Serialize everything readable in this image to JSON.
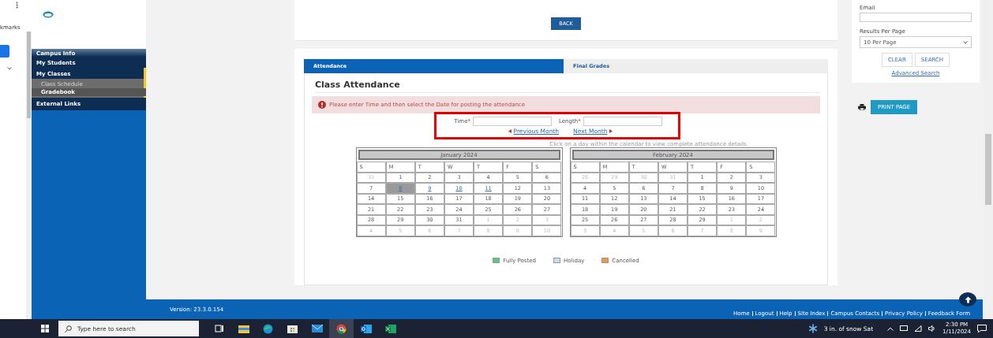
{
  "browser": {
    "bookmarks_label": "kmarks"
  },
  "sidebar": {
    "items": [
      {
        "label": "Campus Info",
        "selected": false
      },
      {
        "label": "My Students",
        "selected": false
      },
      {
        "label": "My Classes",
        "selected": true,
        "expanded": true,
        "children": [
          {
            "label": "Class Schedule",
            "selected": false
          },
          {
            "label": "Gradebook",
            "selected": true
          }
        ]
      },
      {
        "label": "External Links",
        "selected": false
      }
    ]
  },
  "back_button": "BACK",
  "tabs": [
    {
      "label": "Attendance",
      "selected": true
    },
    {
      "label": "Final Grades",
      "selected": false
    }
  ],
  "heading": "Class Attendance",
  "alert": "Please enter Time and then select the Date for posting the attendance",
  "form": {
    "fields": [
      {
        "label": "Time",
        "required_mark": "*"
      },
      {
        "label": "Length",
        "required_mark": "*"
      }
    ],
    "prev_link": "Previous Month",
    "next_link": "Next Month",
    "hint": "Click on a day within the calendar to view complete attendance details."
  },
  "calendars": [
    {
      "title": "January 2024",
      "weekdays": [
        "S",
        "M",
        "T",
        "W",
        "T",
        "F",
        "S"
      ],
      "weeks": [
        [
          {
            "day": "31",
            "muted": true,
            "linked": false,
            "selected": false
          },
          {
            "day": "1",
            "muted": false,
            "linked": false,
            "selected": false
          },
          {
            "day": "2",
            "muted": false,
            "linked": false,
            "selected": false
          },
          {
            "day": "3",
            "muted": false,
            "linked": false,
            "selected": false
          },
          {
            "day": "4",
            "muted": false,
            "linked": false,
            "selected": false
          },
          {
            "day": "5",
            "muted": false,
            "linked": false,
            "selected": false
          },
          {
            "day": "6",
            "muted": false,
            "linked": false,
            "selected": false
          }
        ],
        [
          {
            "day": "7",
            "muted": false,
            "linked": false,
            "selected": false
          },
          {
            "day": "8",
            "muted": false,
            "linked": true,
            "selected": true
          },
          {
            "day": "9",
            "muted": false,
            "linked": true,
            "selected": false
          },
          {
            "day": "10",
            "muted": false,
            "linked": true,
            "selected": false
          },
          {
            "day": "11",
            "muted": false,
            "linked": true,
            "selected": false
          },
          {
            "day": "12",
            "muted": false,
            "linked": false,
            "selected": false
          },
          {
            "day": "13",
            "muted": false,
            "linked": false,
            "selected": false
          }
        ],
        [
          {
            "day": "14",
            "muted": false,
            "linked": false,
            "selected": false
          },
          {
            "day": "15",
            "muted": false,
            "linked": false,
            "selected": false
          },
          {
            "day": "16",
            "muted": false,
            "linked": false,
            "selected": false
          },
          {
            "day": "17",
            "muted": false,
            "linked": false,
            "selected": false
          },
          {
            "day": "18",
            "muted": false,
            "linked": false,
            "selected": false
          },
          {
            "day": "19",
            "muted": false,
            "linked": false,
            "selected": false
          },
          {
            "day": "20",
            "muted": false,
            "linked": false,
            "selected": false
          }
        ],
        [
          {
            "day": "21",
            "muted": false,
            "linked": false,
            "selected": false
          },
          {
            "day": "22",
            "muted": false,
            "linked": false,
            "selected": false
          },
          {
            "day": "23",
            "muted": false,
            "linked": false,
            "selected": false
          },
          {
            "day": "24",
            "muted": false,
            "linked": false,
            "selected": false
          },
          {
            "day": "25",
            "muted": false,
            "linked": false,
            "selected": false
          },
          {
            "day": "26",
            "muted": false,
            "linked": false,
            "selected": false
          },
          {
            "day": "27",
            "muted": false,
            "linked": false,
            "selected": false
          }
        ],
        [
          {
            "day": "28",
            "muted": false,
            "linked": false,
            "selected": false
          },
          {
            "day": "29",
            "muted": false,
            "linked": false,
            "selected": false
          },
          {
            "day": "30",
            "muted": false,
            "linked": false,
            "selected": false
          },
          {
            "day": "31",
            "muted": false,
            "linked": false,
            "selected": false
          },
          {
            "day": "1",
            "muted": true,
            "linked": false,
            "selected": false
          },
          {
            "day": "2",
            "muted": true,
            "linked": false,
            "selected": false
          },
          {
            "day": "3",
            "muted": true,
            "linked": false,
            "selected": false
          }
        ],
        [
          {
            "day": "4",
            "muted": true,
            "linked": false,
            "selected": false
          },
          {
            "day": "5",
            "muted": true,
            "linked": false,
            "selected": false
          },
          {
            "day": "6",
            "muted": true,
            "linked": false,
            "selected": false
          },
          {
            "day": "7",
            "muted": true,
            "linked": false,
            "selected": false
          },
          {
            "day": "8",
            "muted": true,
            "linked": false,
            "selected": false
          },
          {
            "day": "9",
            "muted": true,
            "linked": false,
            "selected": false
          },
          {
            "day": "10",
            "muted": true,
            "linked": false,
            "selected": false
          }
        ]
      ]
    },
    {
      "title": "February 2024",
      "weekdays": [
        "S",
        "M",
        "T",
        "W",
        "T",
        "F",
        "S"
      ],
      "weeks": [
        [
          {
            "day": "28",
            "muted": true,
            "linked": false,
            "selected": false
          },
          {
            "day": "29",
            "muted": true,
            "linked": false,
            "selected": false
          },
          {
            "day": "30",
            "muted": true,
            "linked": false,
            "selected": false
          },
          {
            "day": "31",
            "muted": true,
            "linked": false,
            "selected": false
          },
          {
            "day": "1",
            "muted": false,
            "linked": false,
            "selected": false
          },
          {
            "day": "2",
            "muted": false,
            "linked": false,
            "selected": false
          },
          {
            "day": "3",
            "muted": false,
            "linked": false,
            "selected": false
          }
        ],
        [
          {
            "day": "4",
            "muted": false,
            "linked": false,
            "selected": false
          },
          {
            "day": "5",
            "muted": false,
            "linked": false,
            "selected": false
          },
          {
            "day": "6",
            "muted": false,
            "linked": false,
            "selected": false
          },
          {
            "day": "7",
            "muted": false,
            "linked": false,
            "selected": false
          },
          {
            "day": "8",
            "muted": false,
            "linked": false,
            "selected": false
          },
          {
            "day": "9",
            "muted": false,
            "linked": false,
            "selected": false
          },
          {
            "day": "10",
            "muted": false,
            "linked": false,
            "selected": false
          }
        ],
        [
          {
            "day": "11",
            "muted": false,
            "linked": false,
            "selected": false
          },
          {
            "day": "12",
            "muted": false,
            "linked": false,
            "selected": false
          },
          {
            "day": "13",
            "muted": false,
            "linked": false,
            "selected": false
          },
          {
            "day": "14",
            "muted": false,
            "linked": false,
            "selected": false
          },
          {
            "day": "15",
            "muted": false,
            "linked": false,
            "selected": false
          },
          {
            "day": "16",
            "muted": false,
            "linked": false,
            "selected": false
          },
          {
            "day": "17",
            "muted": false,
            "linked": false,
            "selected": false
          }
        ],
        [
          {
            "day": "18",
            "muted": false,
            "linked": false,
            "selected": false
          },
          {
            "day": "19",
            "muted": false,
            "linked": false,
            "selected": false
          },
          {
            "day": "20",
            "muted": false,
            "linked": false,
            "selected": false
          },
          {
            "day": "21",
            "muted": false,
            "linked": false,
            "selected": false
          },
          {
            "day": "22",
            "muted": false,
            "linked": false,
            "selected": false
          },
          {
            "day": "23",
            "muted": false,
            "linked": false,
            "selected": false
          },
          {
            "day": "24",
            "muted": false,
            "linked": false,
            "selected": false
          }
        ],
        [
          {
            "day": "25",
            "muted": false,
            "linked": false,
            "selected": false
          },
          {
            "day": "26",
            "muted": false,
            "linked": false,
            "selected": false
          },
          {
            "day": "27",
            "muted": false,
            "linked": false,
            "selected": false
          },
          {
            "day": "28",
            "muted": false,
            "linked": false,
            "selected": false
          },
          {
            "day": "29",
            "muted": false,
            "linked": false,
            "selected": false
          },
          {
            "day": "1",
            "muted": true,
            "linked": false,
            "selected": false
          },
          {
            "day": "2",
            "muted": true,
            "linked": false,
            "selected": false
          }
        ],
        [
          {
            "day": "3",
            "muted": true,
            "linked": false,
            "selected": false
          },
          {
            "day": "4",
            "muted": true,
            "linked": false,
            "selected": false
          },
          {
            "day": "5",
            "muted": true,
            "linked": false,
            "selected": false
          },
          {
            "day": "6",
            "muted": true,
            "linked": false,
            "selected": false
          },
          {
            "day": "7",
            "muted": true,
            "linked": false,
            "selected": false
          },
          {
            "day": "8",
            "muted": true,
            "linked": false,
            "selected": false
          },
          {
            "day": "9",
            "muted": true,
            "linked": false,
            "selected": false
          }
        ]
      ]
    }
  ],
  "legend": [
    {
      "label": "Fully Posted",
      "color": "#5cc87a"
    },
    {
      "label": "Holiday",
      "color": "#c9dcf5"
    },
    {
      "label": "Cancelled",
      "color": "#e99a4a"
    }
  ],
  "search_panel": {
    "email_label": "Email",
    "results_label": "Results Per Page",
    "results_value": "10 Per Page",
    "buttons": [
      "CLEAR",
      "SEARCH"
    ],
    "advanced_link": "Advanced Search"
  },
  "print_button": "PRINT PAGE",
  "footer": {
    "version": "Version: 23.3.0.154",
    "links": [
      "Home",
      "Logout",
      "Help",
      "Site Index",
      "Campus Contacts",
      "Privacy Policy",
      "Feedback Form"
    ]
  },
  "taskbar": {
    "search_placeholder": "Type here to search",
    "apps": [
      {
        "kind": "taskview",
        "selected": false
      },
      {
        "kind": "folder",
        "selected": false
      },
      {
        "kind": "edge",
        "selected": false
      },
      {
        "kind": "store",
        "selected": false
      },
      {
        "kind": "mail",
        "selected": false
      },
      {
        "kind": "chrome",
        "selected": true
      },
      {
        "kind": "outlook",
        "selected": false
      },
      {
        "kind": "excel",
        "selected": false
      }
    ],
    "weather": "3 in. of snow Sat",
    "time": "2:30 PM",
    "date": "1/11/2024"
  }
}
